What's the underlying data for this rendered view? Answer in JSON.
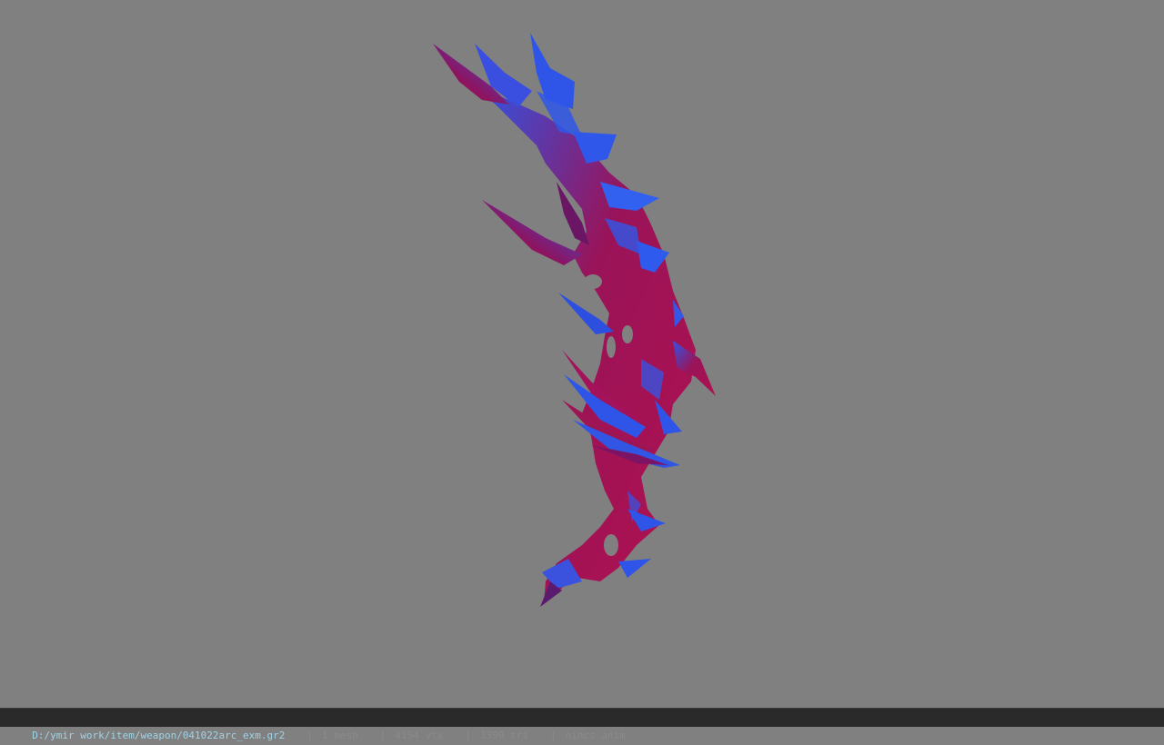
{
  "viewport": {
    "background": "#808080",
    "model": {
      "subject": "weapon-mesh",
      "colors": {
        "red": "#b0124f",
        "blue": "#2e55e8",
        "dark": "#6a0f48"
      }
    }
  },
  "statusbar": {
    "path": "D:/ymir work/item/weapon/041022arc_exm.gr2",
    "separator": "|",
    "mesh": "1 mesh",
    "vtx": "4154 vtx",
    "tri": "1390 tri",
    "anim": "nincs anim"
  }
}
